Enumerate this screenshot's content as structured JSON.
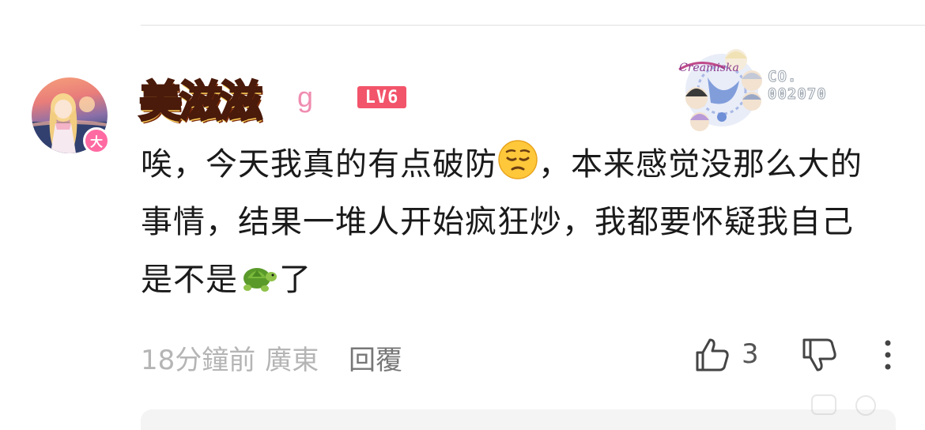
{
  "comment": {
    "author": {
      "name_art": "美滋滋",
      "name_tail": "g",
      "level": "LV6",
      "vip_badge": "大"
    },
    "pendant": {
      "brand": "Creamiska",
      "code_line1": "CO.",
      "code_line2": "002070"
    },
    "text_parts": {
      "p1": "唉，今天我真的有点破防",
      "p2": "，本来感觉没那么大的事情，结果一堆人开始疯狂炒，我都要怀疑我自己是不是",
      "p3": "了"
    },
    "emojis": [
      "pensive-face",
      "turtle"
    ],
    "meta": {
      "time": "18分鐘前",
      "location": "廣東"
    },
    "reply_label": "回覆",
    "like_count": "3"
  },
  "colors": {
    "level_badge": "#f2546a",
    "vip_badge": "#ff6aa2",
    "username_art": "#ff9a1a",
    "meta_text": "#b5b5b5"
  }
}
